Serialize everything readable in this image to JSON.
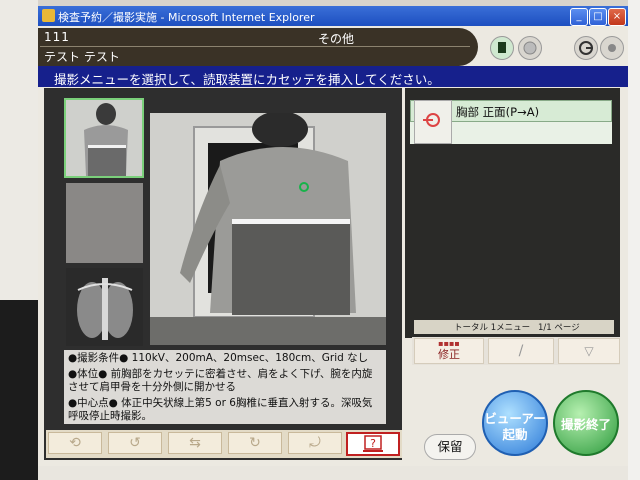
{
  "window": {
    "title": "検査予約／撮影実施 - Microsoft Internet Explorer",
    "min": "_",
    "max": "□",
    "close": "×"
  },
  "header": {
    "patient_id": "111",
    "exam_type": "その他",
    "patient_name": "テスト テスト"
  },
  "instruction": "撮影メニューを選択して、読取装置にカセッテを挿入してください。",
  "menu": {
    "item_label": "胸部 正面(P→A)"
  },
  "counter": {
    "total": "トータル 1メニュー",
    "page": "1/1 ページ"
  },
  "nav": {
    "correct_label": "修正"
  },
  "info": {
    "conditions": "●撮影条件● 110kV、200mA、20msec、180cm、Grid なし",
    "position": "●体位● 前胸部をカセッテに密着させ、肩をよく下げ、腕を内旋させて肩甲骨を十分外側に開かせる",
    "center": "●中心点● 体正中矢状線上第5 or 6胸椎に垂直入射する。深吸気呼吸停止時撮影。"
  },
  "buttons": {
    "hold": "保留",
    "viewer": "ビューアー\n起動",
    "end": "撮影終了",
    "help": "?"
  },
  "toolbar_icons": [
    "undo-icon",
    "rotate-left-icon",
    "flip-icon",
    "rotate-right-icon",
    "reset-icon"
  ],
  "colors": {
    "instruction_bg": "#16208c",
    "header_bg": "#3a3226",
    "selected_green": "#7bd07b",
    "viewer_blue": "#2c7ad8",
    "end_green": "#2c9a3c"
  }
}
